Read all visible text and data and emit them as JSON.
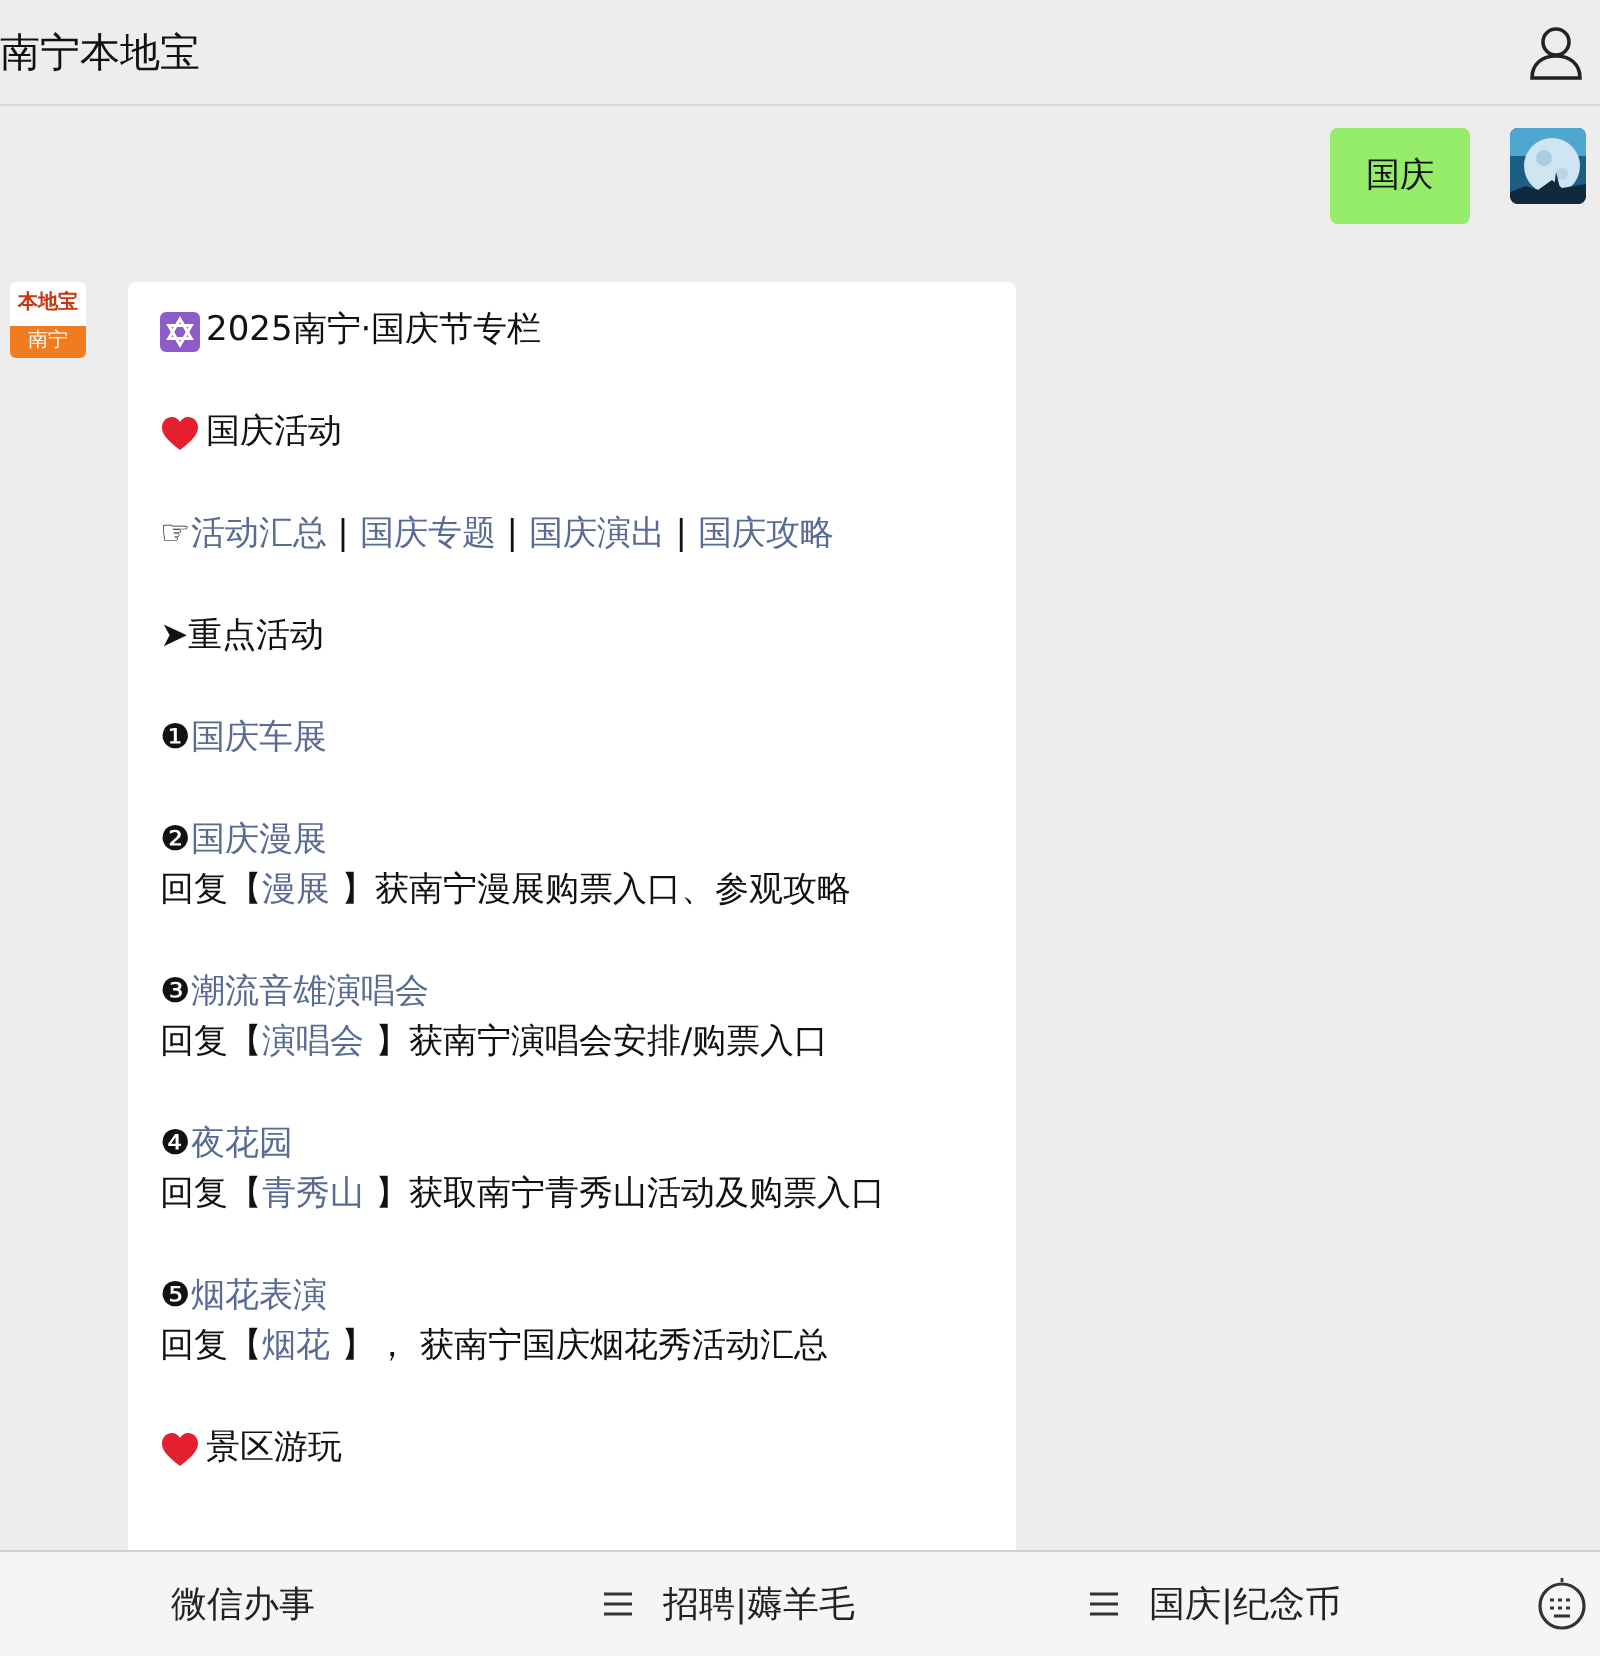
{
  "header": {
    "title": "南宁本地宝"
  },
  "messages": [
    {
      "kind": "sent",
      "text": "国庆"
    },
    {
      "kind": "received",
      "avatar": {
        "top": "本地宝",
        "bottom": "南宁"
      },
      "blocks": [
        {
          "kind": "title",
          "lines": [
            [
              {
                "text": "2025南宁·国庆节专栏",
                "link": false
              }
            ]
          ]
        },
        {
          "kind": "section",
          "lines": [
            [
              {
                "text": "国庆活动",
                "link": false
              }
            ]
          ]
        },
        {
          "lines": [
            [
              {
                "text": "☞",
                "link": false
              },
              {
                "text": "活动汇总",
                "link": true
              },
              {
                "text": " | ",
                "link": false
              },
              {
                "text": "国庆专题",
                "link": true
              },
              {
                "text": " | ",
                "link": false
              },
              {
                "text": "国庆演出",
                "link": true
              },
              {
                "text": " | ",
                "link": false
              },
              {
                "text": "国庆攻略",
                "link": true
              }
            ]
          ]
        },
        {
          "lines": [
            [
              {
                "text": "➤重点活动",
                "link": false
              }
            ]
          ]
        },
        {
          "lines": [
            [
              {
                "text": "❶",
                "link": false
              },
              {
                "text": "国庆车展",
                "link": true
              }
            ]
          ]
        },
        {
          "lines": [
            [
              {
                "text": "❷",
                "link": false
              },
              {
                "text": "国庆漫展",
                "link": true
              }
            ],
            [
              {
                "text": "回复【",
                "link": false
              },
              {
                "text": "漫展",
                "link": true
              },
              {
                "text": " 】获南宁漫展购票入口、参观攻略",
                "link": false
              }
            ]
          ]
        },
        {
          "lines": [
            [
              {
                "text": "❸",
                "link": false
              },
              {
                "text": "潮流音雄演唱会",
                "link": true
              }
            ],
            [
              {
                "text": "回复【",
                "link": false
              },
              {
                "text": "演唱会",
                "link": true
              },
              {
                "text": " 】获南宁演唱会安排/购票入口",
                "link": false
              }
            ]
          ]
        },
        {
          "lines": [
            [
              {
                "text": "❹",
                "link": false
              },
              {
                "text": "夜花园",
                "link": true
              }
            ],
            [
              {
                "text": "回复【",
                "link": false
              },
              {
                "text": "青秀山",
                "link": true
              },
              {
                "text": " 】获取南宁青秀山活动及购票入口",
                "link": false
              }
            ]
          ]
        },
        {
          "lines": [
            [
              {
                "text": "❺",
                "link": false
              },
              {
                "text": "烟花表演",
                "link": true
              }
            ],
            [
              {
                "text": "回复【",
                "link": false
              },
              {
                "text": "烟花",
                "link": true
              },
              {
                "text": " 】， 获南宁国庆烟花秀活动汇总",
                "link": false
              }
            ]
          ]
        },
        {
          "kind": "section",
          "lines": [
            [
              {
                "text": "景区游玩",
                "link": false
              }
            ]
          ]
        }
      ]
    }
  ],
  "menu": [
    {
      "label": "微信办事",
      "submenu": false
    },
    {
      "label": "招聘|薅羊毛",
      "submenu": true
    },
    {
      "label": "国庆|纪念币",
      "submenu": true
    }
  ]
}
